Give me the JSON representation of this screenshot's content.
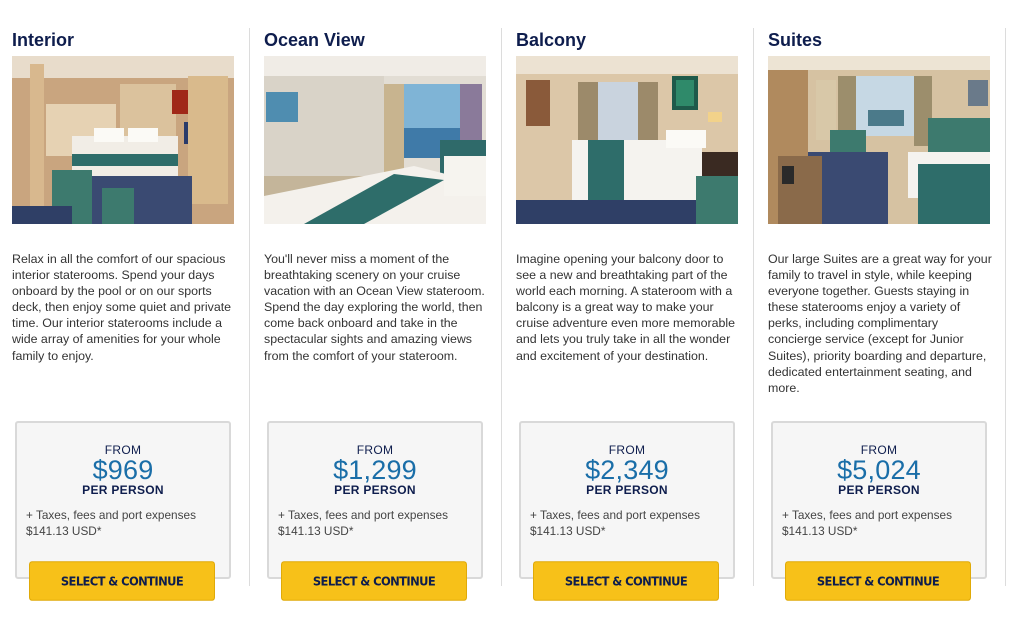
{
  "cards": [
    {
      "title": "Interior",
      "description": "Relax in all the comfort of our spacious interior staterooms. Spend your days onboard by the pool or on our sports deck, then enjoy some quiet and private time. Our interior staterooms include a wide array of amenities for your whole family to enjoy.",
      "from_label": "FROM",
      "price": "$969",
      "per_person": "PER PERSON",
      "taxes_line1": "+ Taxes, fees and port expenses",
      "taxes_line2": "$141.13 USD*",
      "button": "SELECT & CONTINUE"
    },
    {
      "title": "Ocean View",
      "description": "You'll never miss a moment of the breathtaking scenery on your cruise vacation with an Ocean View stateroom. Spend the day exploring the world, then come back onboard and take in the spectacular sights and amazing views from the comfort of your stateroom.",
      "from_label": "FROM",
      "price": "$1,299",
      "per_person": "PER PERSON",
      "taxes_line1": "+ Taxes, fees and port expenses",
      "taxes_line2": "$141.13 USD*",
      "button": "SELECT & CONTINUE"
    },
    {
      "title": "Balcony",
      "description": "Imagine opening your balcony door to see a new and breathtaking part of the world each morning. A stateroom with a balcony is a great way to make your cruise adventure even more memorable and lets you truly take in all the wonder and excitement of your destination.",
      "from_label": "FROM",
      "price": "$2,349",
      "per_person": "PER PERSON",
      "taxes_line1": "+ Taxes, fees and port expenses",
      "taxes_line2": "$141.13 USD*",
      "button": "SELECT & CONTINUE"
    },
    {
      "title": "Suites",
      "description": "Our large Suites are a great way for your family to travel in style, while keeping everyone together. Guests staying in these staterooms enjoy a variety of perks, including complimentary concierge service (except for Junior Suites), priority boarding and departure, dedicated entertainment seating, and more.",
      "from_label": "FROM",
      "price": "$5,024",
      "per_person": "PER PERSON",
      "taxes_line1": "+ Taxes, fees and port expenses",
      "taxes_line2": "$141.13 USD*",
      "button": "SELECT & CONTINUE"
    }
  ],
  "colors": {
    "title": "#0e1d4d",
    "price": "#1a6ea8",
    "button": "#f7c119"
  }
}
